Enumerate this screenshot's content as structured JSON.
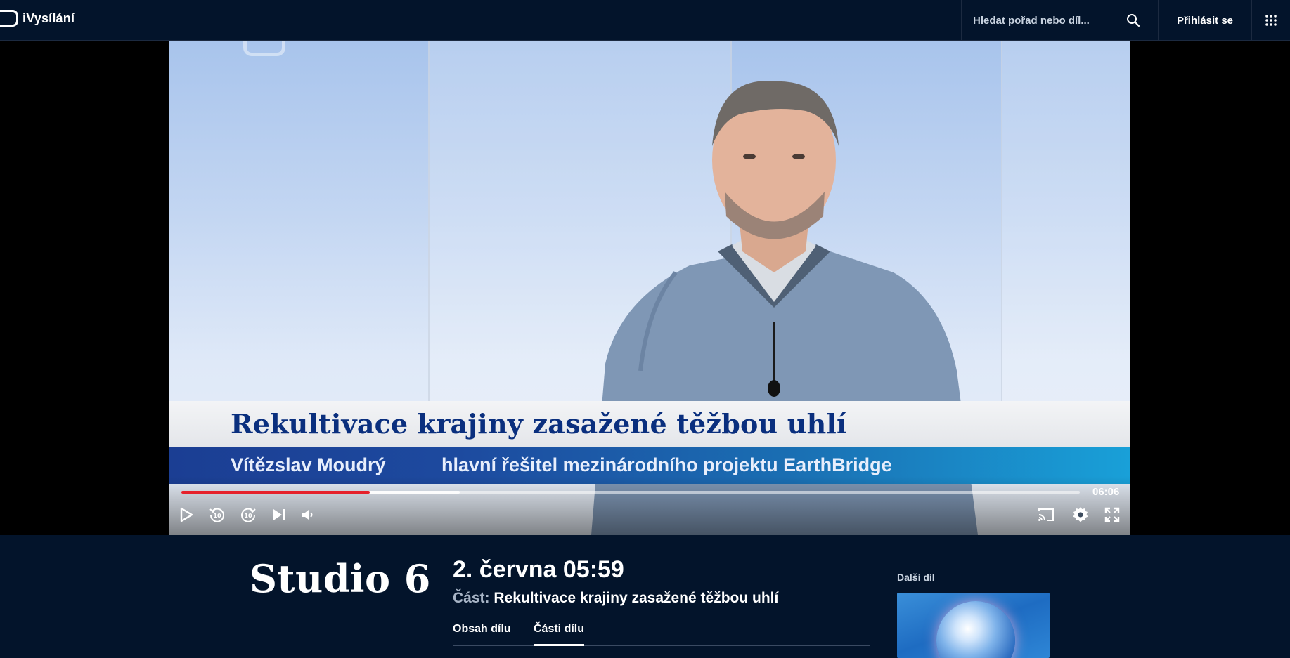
{
  "header": {
    "logo_text": "iVysílání",
    "search_placeholder": "Hledat pořad nebo díl...",
    "login_label": "Přihlásit se"
  },
  "video": {
    "lower_third_title": "Rekultivace krajiny zasažené těžbou uhlí",
    "lower_third_name": "Vítězslav Moudrý",
    "lower_third_role": "hlavní řešitel mezinárodního projektu EarthBridge",
    "remaining_time": "06:06",
    "progress_played_fraction": 0.21,
    "progress_buffered_fraction": 0.31,
    "accent_color": "#e5212b"
  },
  "controls": {
    "icons": [
      "play-icon",
      "rewind-10-icon",
      "forward-10-icon",
      "next-episode-icon",
      "volume-icon",
      "cast-icon",
      "settings-icon",
      "fullscreen-icon"
    ],
    "rewind_label": "10",
    "forward_label": "10"
  },
  "episode": {
    "show_title": "Studio 6",
    "date_time": "2. června 05:59",
    "part_prefix": "Část:",
    "part_title": "Rekultivace krajiny zasažené těžbou uhlí",
    "tabs": [
      {
        "label": "Obsah dílu",
        "active": false
      },
      {
        "label": "Části dílu",
        "active": true
      }
    ],
    "next_label": "Další díl"
  }
}
